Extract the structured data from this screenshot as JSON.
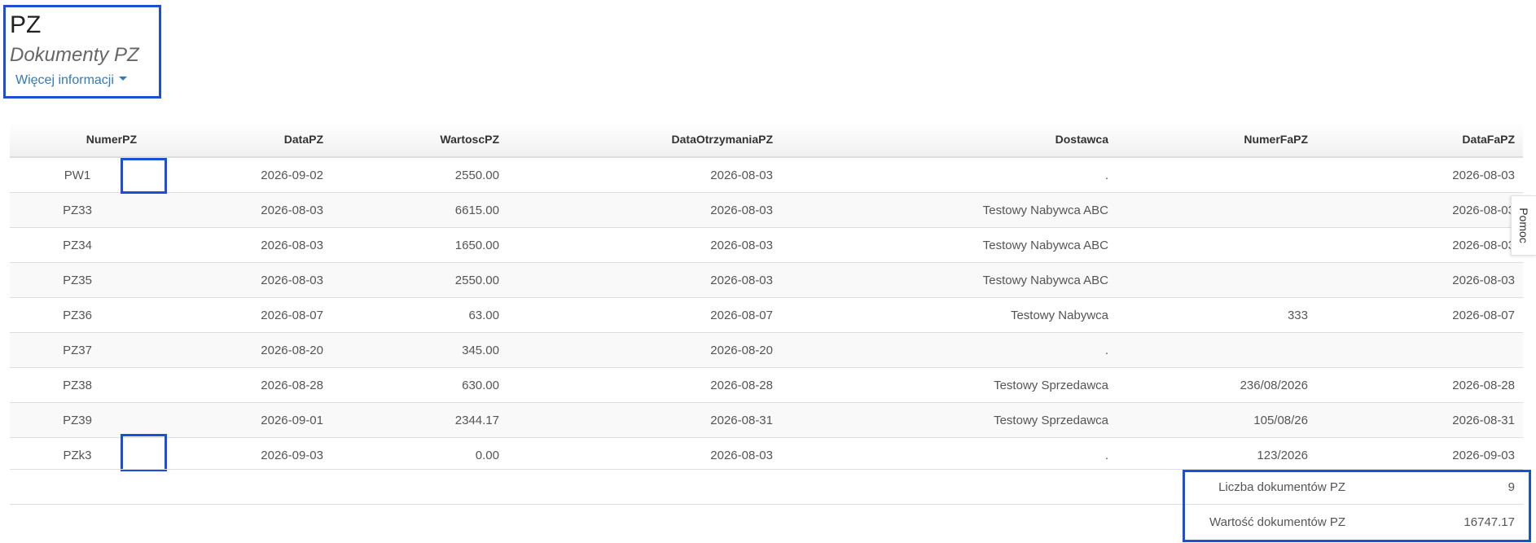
{
  "header": {
    "title": "PZ",
    "subtitle": "Dokumenty PZ",
    "more_info": "Więcej informacji"
  },
  "table": {
    "columns": [
      "NumerPZ",
      "DataPZ",
      "WartoscPZ",
      "DataOtrzymaniaPZ",
      "Dostawca",
      "NumerFaPZ",
      "DataFaPZ"
    ],
    "rows": [
      [
        "PW1",
        "2026-09-02",
        "2550.00",
        "2026-08-03",
        ".",
        "",
        "2026-08-03"
      ],
      [
        "PZ33",
        "2026-08-03",
        "6615.00",
        "2026-08-03",
        "Testowy Nabywca ABC",
        "",
        "2026-08-03"
      ],
      [
        "PZ34",
        "2026-08-03",
        "1650.00",
        "2026-08-03",
        "Testowy Nabywca ABC",
        "",
        "2026-08-03"
      ],
      [
        "PZ35",
        "2026-08-03",
        "2550.00",
        "2026-08-03",
        "Testowy Nabywca ABC",
        "",
        "2026-08-03"
      ],
      [
        "PZ36",
        "2026-08-07",
        "63.00",
        "2026-08-07",
        "Testowy Nabywca",
        "333",
        "2026-08-07"
      ],
      [
        "PZ37",
        "2026-08-20",
        "345.00",
        "2026-08-20",
        ".",
        "",
        ""
      ],
      [
        "PZ38",
        "2026-08-28",
        "630.00",
        "2026-08-28",
        "Testowy Sprzedawca",
        "236/08/2026",
        "2026-08-28"
      ],
      [
        "PZ39",
        "2026-09-01",
        "2344.17",
        "2026-08-31",
        "Testowy Sprzedawca",
        "105/08/26",
        "2026-08-31"
      ],
      [
        "PZk3",
        "2026-09-03",
        "0.00",
        "2026-08-03",
        ".",
        "123/2026",
        "2026-09-03"
      ]
    ]
  },
  "summary": {
    "count_label": "Liczba dokumentów PZ",
    "count_value": "9",
    "total_label": "Wartość dokumentów PZ",
    "total_value": "16747.17"
  },
  "help_tab": {
    "label": "Pomoc"
  }
}
